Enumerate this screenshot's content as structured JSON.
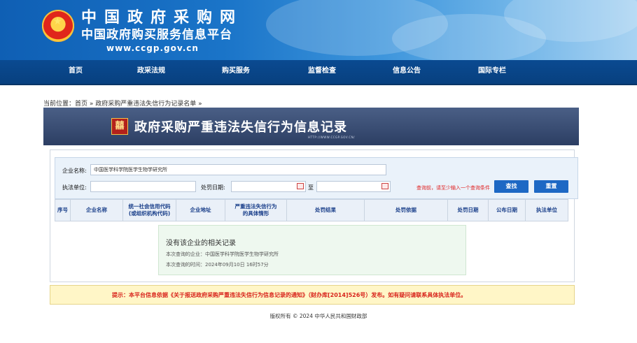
{
  "header": {
    "site_name": "中国政府采购网",
    "site_subtitle": "中国政府购买服务信息平台",
    "site_url": "www.ccgp.gov.cn"
  },
  "nav": {
    "items": [
      "首页",
      "政采法规",
      "购买服务",
      "监督检查",
      "信息公告",
      "国际专栏"
    ]
  },
  "breadcrumb": {
    "text": "当前位置：首页 » 政府采购严重违法失信行为记录名单 »"
  },
  "page": {
    "title": "政府采购严重违法失信行为信息记录",
    "title_url": "HTTP://WWW.CCGP.GOV.CN/",
    "title_icon": "seal-icon"
  },
  "search": {
    "company_label": "企业名称:",
    "company_value": "中国医学科学院医学生物学研究所",
    "agency_label": "执法单位:",
    "agency_value": "",
    "date_label": "处罚日期:",
    "date_from": "",
    "date_to_label": "至",
    "date_to": "",
    "tip": "查询前，请至少输入一个查询条件",
    "search_button": "查找",
    "reset_button": "重置"
  },
  "table": {
    "columns": [
      "序号",
      "企业名称",
      "统一社会信用代码\n(或组织机构代码)",
      "企业地址",
      "严重违法失信行为\n的具体情形",
      "处罚结果",
      "处罚依据",
      "处罚日期",
      "公布日期",
      "执法单位"
    ]
  },
  "empty_result": {
    "title": "没有该企业的相关记录",
    "company_line": "本次查询的企业：中国医学科学院医学生物学研究所",
    "time_line": "本次查询的时间：2024年09月10日 16时57分"
  },
  "notice": {
    "text": "提示：本平台信息依据《关于报送政府采购严重违法失信行为信息记录的通知》（财办库[2014]526号）发布。如有疑问请联系具体执法单位。"
  },
  "footer": {
    "copyright": "版权所有 © 2024 中华人民共和国财政部"
  },
  "colors": {
    "banner": "#1a74c8",
    "nav": "#0a4a91",
    "title_band": "#2c3e63",
    "button": "#1d68c4",
    "tip": "#e02020",
    "notice_bg": "#fff6c7"
  }
}
